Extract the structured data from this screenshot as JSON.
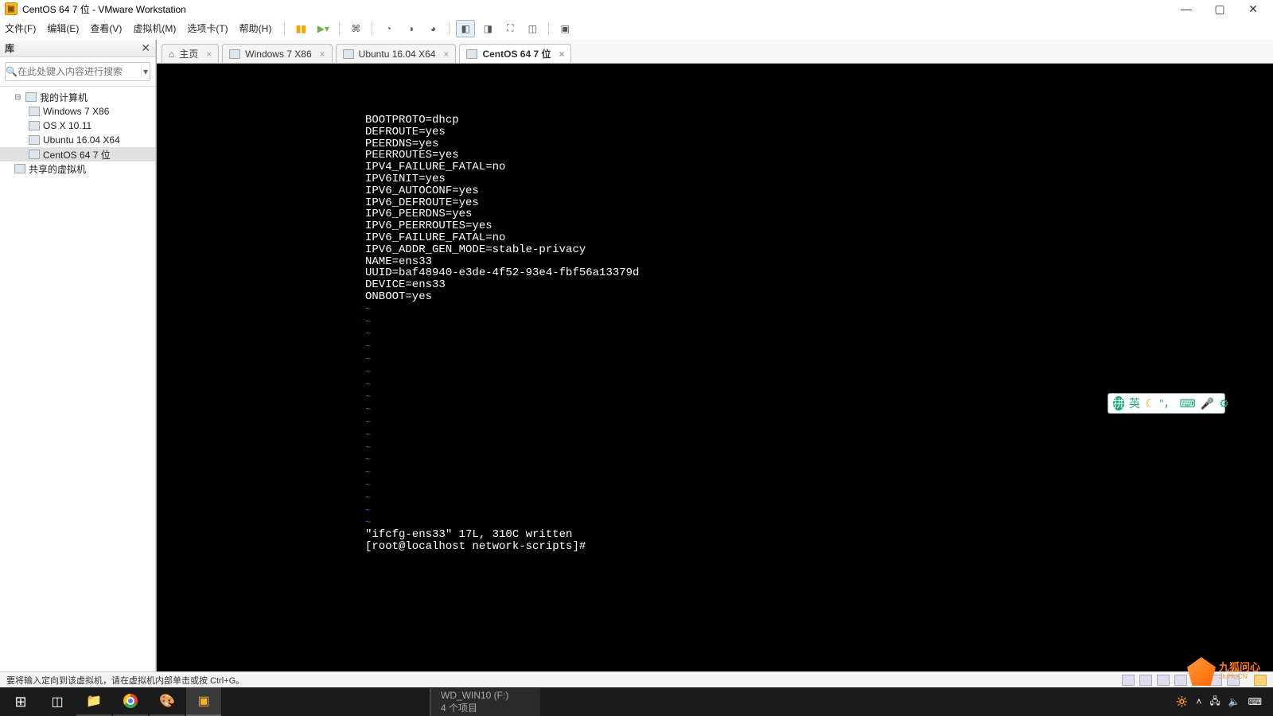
{
  "window": {
    "title": "CentOS 64 7 位 - VMware Workstation"
  },
  "menu": {
    "file": "文件(F)",
    "edit": "编辑(E)",
    "view": "查看(V)",
    "vm": "虚拟机(M)",
    "tabs": "选项卡(T)",
    "help": "帮助(H)"
  },
  "sidebar": {
    "title": "库",
    "search_placeholder": "在此处键入内容进行搜索",
    "root": "我的计算机",
    "items": [
      {
        "label": "Windows 7 X86"
      },
      {
        "label": "OS X 10.11"
      },
      {
        "label": "Ubuntu 16.04 X64"
      },
      {
        "label": "CentOS 64 7 位"
      }
    ],
    "shared": "共享的虚拟机"
  },
  "tabs": {
    "home": "主页",
    "list": [
      {
        "label": "Windows 7 X86"
      },
      {
        "label": "Ubuntu 16.04 X64"
      },
      {
        "label": "CentOS 64 7 位"
      }
    ]
  },
  "terminal": {
    "lines": [
      "BOOTPROTO=dhcp",
      "DEFROUTE=yes",
      "PEERDNS=yes",
      "PEERROUTES=yes",
      "IPV4_FAILURE_FATAL=no",
      "IPV6INIT=yes",
      "IPV6_AUTOCONF=yes",
      "IPV6_DEFROUTE=yes",
      "IPV6_PEERDNS=yes",
      "IPV6_PEERROUTES=yes",
      "IPV6_FAILURE_FATAL=no",
      "IPV6_ADDR_GEN_MODE=stable-privacy",
      "NAME=ens33",
      "UUID=baf48940-e3de-4f52-93e4-fbf56a13379d",
      "DEVICE=ens33",
      "ONBOOT=yes"
    ],
    "tilde_rows": 18,
    "status_line": "\"ifcfg-ens33\" 17L, 310C written",
    "prompt": "[root@localhost network-scripts]#"
  },
  "ime": {
    "lang": "英",
    "moon": "☾"
  },
  "statusbar": {
    "text": "要将输入定向到该虚拟机，请在虚拟机内部单击或按 Ctrl+G。"
  },
  "windows_taskbar": {
    "wd_title": "WD_WIN10 (F:)",
    "wd_sub": "4 个项目"
  },
  "watermark": {
    "title": "九狐问心",
    "sub": "JiuHuCN"
  }
}
